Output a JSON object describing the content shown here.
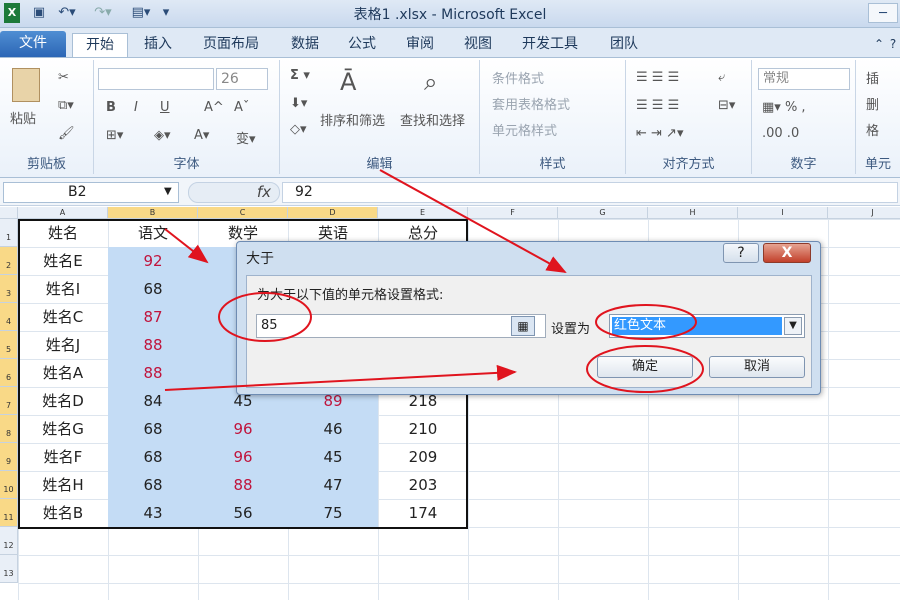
{
  "window": {
    "title": "表格1 .xlsx - Microsoft Excel"
  },
  "tabs": [
    "文件",
    "开始",
    "插入",
    "页面布局",
    "数据",
    "公式",
    "审阅",
    "视图",
    "开发工具",
    "团队"
  ],
  "ribbon": {
    "clipboard": {
      "label": "剪贴板",
      "paste": "粘贴"
    },
    "font": {
      "label": "字体",
      "size": "26",
      "bold": "B",
      "italic": "I",
      "underline": "U"
    },
    "editing": {
      "label": "编辑",
      "sort": "排序和筛选",
      "find": "查找和选择"
    },
    "styles": {
      "label": "样式",
      "cond": "条件格式",
      "table": "套用表格格式",
      "cell": "单元格样式"
    },
    "align": {
      "label": "对齐方式"
    },
    "number": {
      "label": "数字",
      "format": "常规"
    },
    "cells": {
      "label": "单元",
      "insert": "插",
      "delete": "删",
      "format": "格"
    }
  },
  "formula": {
    "namebox": "B2",
    "fx": "fx",
    "value": "92"
  },
  "sheet": {
    "columns": [
      "A",
      "B",
      "C",
      "D",
      "E",
      "F",
      "G",
      "H",
      "I",
      "J"
    ],
    "rows": [
      "1",
      "2",
      "3",
      "4",
      "5",
      "6",
      "7",
      "8",
      "9",
      "10",
      "11",
      "12",
      "13"
    ],
    "header": [
      "姓名",
      "语文",
      "数学",
      "英语",
      "总分"
    ],
    "data": [
      [
        "姓名E",
        "92",
        "",
        "",
        ""
      ],
      [
        "姓名I",
        "68",
        "",
        "",
        ""
      ],
      [
        "姓名C",
        "87",
        "",
        "",
        ""
      ],
      [
        "姓名J",
        "88",
        "",
        "",
        ""
      ],
      [
        "姓名A",
        "88",
        "",
        "",
        ""
      ],
      [
        "姓名D",
        "84",
        "45",
        "89",
        "218"
      ],
      [
        "姓名G",
        "68",
        "96",
        "46",
        "210"
      ],
      [
        "姓名F",
        "68",
        "96",
        "45",
        "209"
      ],
      [
        "姓名H",
        "68",
        "88",
        "47",
        "203"
      ],
      [
        "姓名B",
        "43",
        "56",
        "75",
        "174"
      ]
    ]
  },
  "dialog": {
    "title": "大于",
    "help": "?",
    "close": "X",
    "prompt": "为大于以下值的单元格设置格式:",
    "value": "85",
    "setas": "设置为",
    "format": "红色文本",
    "ok": "确定",
    "cancel": "取消"
  },
  "colors": {
    "accent": "#2c66b5",
    "highlight": "#c4dcf5",
    "red_text": "#c0143c",
    "annotation": "#e0141e"
  }
}
